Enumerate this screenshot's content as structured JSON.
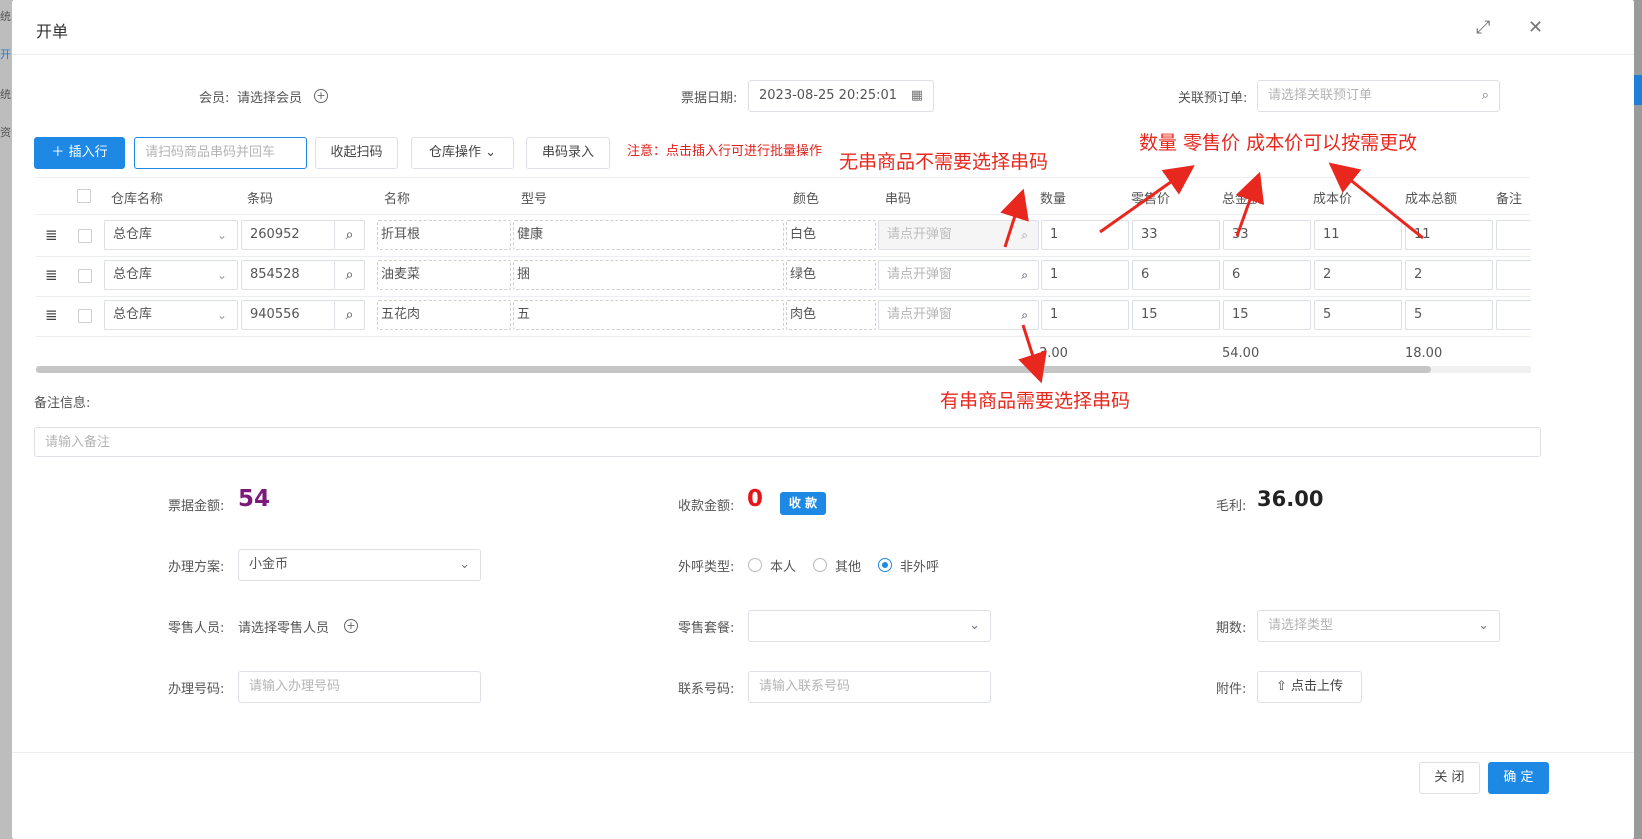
{
  "backdrop": {
    "fragments": [
      "统",
      "开",
      "统",
      "资"
    ]
  },
  "dialog": {
    "title": "开单",
    "maximize_icon": "expand-icon",
    "close_icon": "close-icon"
  },
  "header_fields": {
    "member_label": "会员:",
    "member_value": "请选择会员",
    "date_label": "票据日期:",
    "date_value": "2023-08-25 20:25:01",
    "preorder_label": "关联预订单:",
    "preorder_placeholder": "请选择关联预订单"
  },
  "toolbar": {
    "insert_row": "插入行",
    "scan_placeholder": "请扫码商品串码并回车",
    "collapse_scan": "收起扫码",
    "warehouse_ops": "仓库操作",
    "serial_entry": "串码录入",
    "note": "注意：点击插入行可进行批量操作"
  },
  "annotations": {
    "no_serial": "无串商品不需要选择串码",
    "editable": "数量 零售价 成本价可以按需更改",
    "has_serial": "有串商品需要选择串码"
  },
  "table": {
    "headers": {
      "warehouse": "仓库名称",
      "barcode": "条码",
      "name": "名称",
      "model": "型号",
      "color": "颜色",
      "serial": "串码",
      "qty": "数量",
      "retail": "零售价",
      "total": "总金额",
      "cost": "成本价",
      "cost_total": "成本总额",
      "remark": "备注"
    },
    "rows": [
      {
        "warehouse": "总仓库",
        "barcode": "260952",
        "name": "折耳根",
        "model": "健康",
        "color": "白色",
        "serial_placeholder": "请点开弹窗",
        "qty": "1",
        "retail": "33",
        "total": "33",
        "cost": "11",
        "cost_total": "11"
      },
      {
        "warehouse": "总仓库",
        "barcode": "854528",
        "name": "油麦菜",
        "model": "捆",
        "color": "绿色",
        "serial_placeholder": "请点开弹窗",
        "qty": "1",
        "retail": "6",
        "total": "6",
        "cost": "2",
        "cost_total": "2"
      },
      {
        "warehouse": "总仓库",
        "barcode": "940556",
        "name": "五花肉",
        "model": "五",
        "color": "肉色",
        "serial_placeholder": "请点开弹窗",
        "qty": "1",
        "retail": "15",
        "total": "15",
        "cost": "5",
        "cost_total": "5"
      }
    ],
    "summary": {
      "qty": "3.00",
      "total": "54.00",
      "cost_total": "18.00"
    }
  },
  "remark": {
    "label": "备注信息:",
    "placeholder": "请输入备注"
  },
  "totals": {
    "bill_label": "票据金额:",
    "bill_value": "54",
    "received_label": "收款金额:",
    "received_value": "0",
    "collect_button": "收 款",
    "profit_label": "毛利:",
    "profit_value": "36.00"
  },
  "form": {
    "plan_label": "办理方案:",
    "plan_value": "小金币",
    "call_type_label": "外呼类型:",
    "call_options": [
      "本人",
      "其他",
      "非外呼"
    ],
    "call_selected": "非外呼",
    "sales_person_label": "零售人员:",
    "sales_person_value": "请选择零售人员",
    "package_label": "零售套餐:",
    "period_label": "期数:",
    "period_placeholder": "请选择类型",
    "handle_no_label": "办理号码:",
    "handle_no_placeholder": "请输入办理号码",
    "contact_label": "联系号码:",
    "contact_placeholder": "请输入联系号码",
    "attach_label": "附件:",
    "upload_button": "点击上传"
  },
  "footer": {
    "close": "关 闭",
    "confirm": "确 定"
  },
  "colors": {
    "primary": "#1e88e5",
    "annotation": "#e8281e",
    "bill": "#7b1a7b",
    "received": "#e8161b"
  }
}
